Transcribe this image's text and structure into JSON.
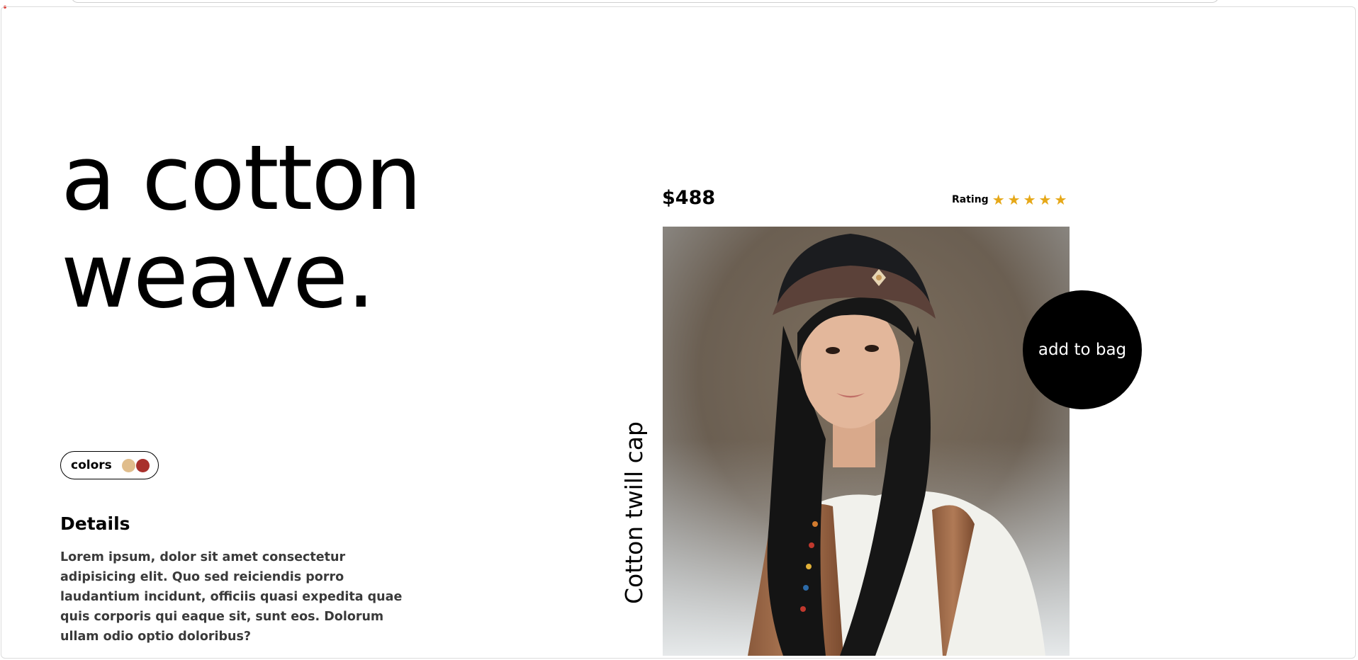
{
  "hero": {
    "title_line1": "a cotton",
    "title_line2": "weave."
  },
  "colors": {
    "label": "colors",
    "swatches": [
      "#e0bd8c",
      "#a8302c"
    ]
  },
  "details": {
    "title": "Details",
    "body": "Lorem ipsum, dolor sit amet consectetur adipisicing elit. Quo sed reiciendis porro laudantium incidunt, officiis quasi expedita quae quis corporis qui eaque sit, sunt eos. Dolorum ullam odio optio doloribus?"
  },
  "product": {
    "price": "$488",
    "rating_label": "Rating",
    "rating_value": 5,
    "rating_max": 5,
    "name": "Cotton twill cap",
    "add_to_bag_label": "add to bag"
  },
  "colors_theme": {
    "star": "#e6a818",
    "button_bg": "#000000",
    "button_text": "#ffffff"
  }
}
